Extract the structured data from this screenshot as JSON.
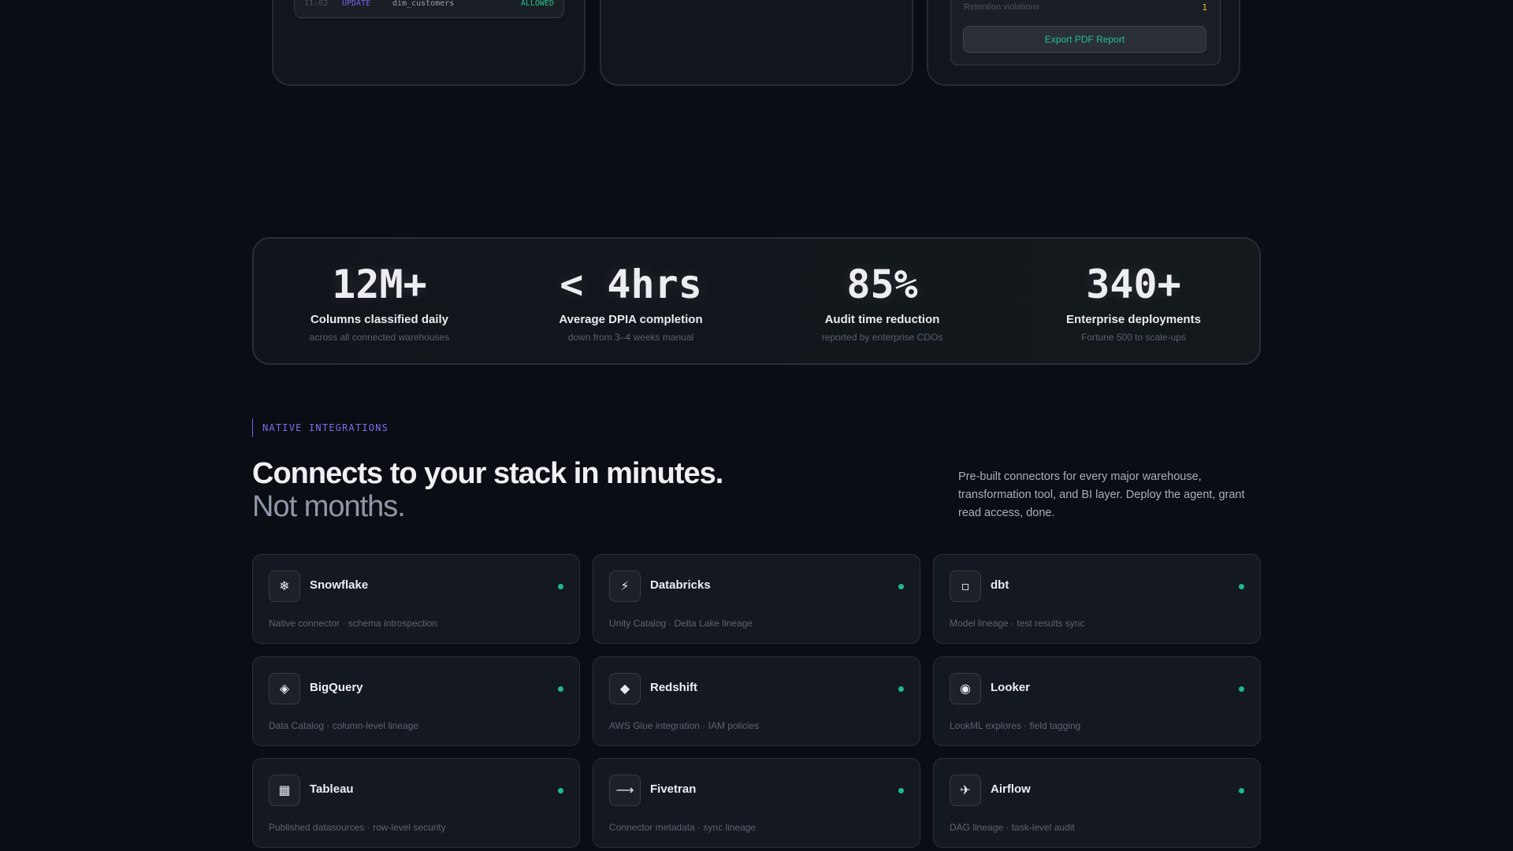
{
  "top_cards": {
    "audit_log": {
      "time": "11:02",
      "operation": "UPDATE",
      "table": "dim_customers",
      "result": "ALLOWED"
    },
    "report": {
      "row_label": "Retention violations",
      "row_value": "1",
      "export_button": "Export PDF Report"
    }
  },
  "stats": [
    {
      "value": "12M+",
      "label": "Columns classified daily",
      "sub": "across all connected warehouses"
    },
    {
      "value": "< 4hrs",
      "label": "Average DPIA completion",
      "sub": "down from 3–4 weeks manual"
    },
    {
      "value": "85%",
      "label": "Audit time reduction",
      "sub": "reported by enterprise CDOs"
    },
    {
      "value": "340+",
      "label": "Enterprise deployments",
      "sub": "Fortune 500 to scale-ups"
    }
  ],
  "integrations": {
    "eyebrow": "NATIVE INTEGRATIONS",
    "headline_1": "Connects to your stack in minutes.",
    "headline_2": "Not months.",
    "blurb": "Pre-built connectors for every major warehouse, transformation tool, and BI layer. Deploy the agent, grant read access, done.",
    "cards": [
      {
        "name": "Snowflake",
        "glyph": "❄",
        "icon": "snowflake-icon",
        "desc": "Native connector · schema introspection"
      },
      {
        "name": "Databricks",
        "glyph": "⚡",
        "icon": "lightning-icon",
        "desc": "Unity Catalog · Delta Lake lineage"
      },
      {
        "name": "dbt",
        "glyph": "▫",
        "icon": "square-icon",
        "desc": "Model lineage · test results sync"
      },
      {
        "name": "BigQuery",
        "glyph": "◈",
        "icon": "diamond-outline-icon",
        "desc": "Data Catalog · column-level lineage"
      },
      {
        "name": "Redshift",
        "glyph": "◆",
        "icon": "diamond-icon",
        "desc": "AWS Glue integration · IAM policies"
      },
      {
        "name": "Looker",
        "glyph": "◉",
        "icon": "circle-target-icon",
        "desc": "LookML explores · field tagging"
      },
      {
        "name": "Tableau",
        "glyph": "▦",
        "icon": "grid-icon",
        "desc": "Published datasources · row-level security"
      },
      {
        "name": "Fivetran",
        "glyph": "⟶",
        "icon": "arrow-right-icon",
        "desc": "Connector metadata · sync lineage"
      },
      {
        "name": "Airflow",
        "glyph": "✈",
        "icon": "airplane-icon",
        "desc": "DAG lineage · task-level audit"
      }
    ]
  },
  "colors": {
    "background": "#0a0d13",
    "accent_purple": "#6f63e8",
    "status_green": "#1fb987",
    "warning_yellow": "#e3c24a"
  }
}
